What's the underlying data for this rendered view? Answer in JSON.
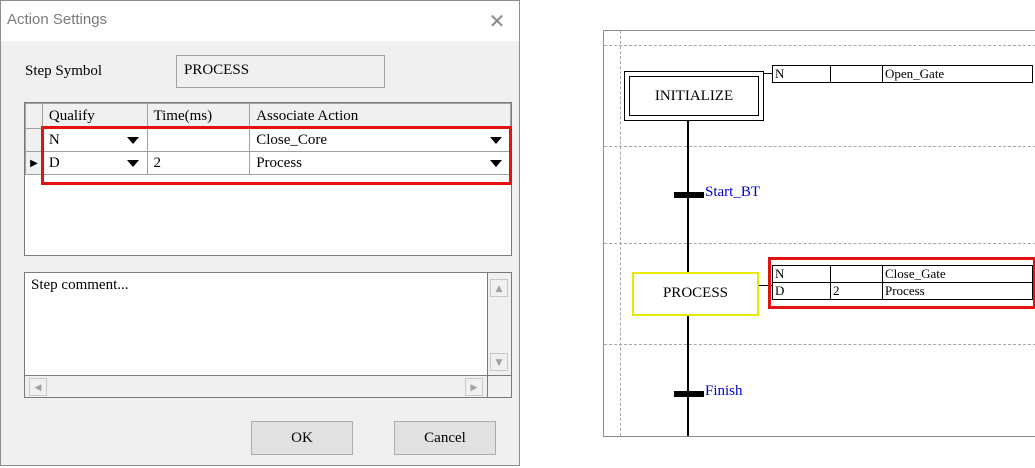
{
  "dialog": {
    "title": "Action Settings",
    "close_glyph": "✕",
    "step_symbol_label": "Step Symbol",
    "step_symbol_value": "PROCESS",
    "grid": {
      "columns": [
        "Qualify",
        "Time(ms)",
        "Associate Action"
      ],
      "rows": [
        {
          "marker": "",
          "qualify": "N",
          "time": "",
          "action": "Close_Core"
        },
        {
          "marker": "▶",
          "qualify": "D",
          "time": "2",
          "action": "Process"
        }
      ]
    },
    "comment_placeholder": "Step comment...",
    "ok_label": "OK",
    "cancel_label": "Cancel"
  },
  "sfc": {
    "init_step": "INITIALIZE",
    "init_action": {
      "qualify": "N",
      "time": "",
      "action": "Open_Gate"
    },
    "transition1": "Start_BT",
    "process_step": "PROCESS",
    "process_actions": [
      {
        "qualify": "N",
        "time": "",
        "action": "Close_Gate"
      },
      {
        "qualify": "D",
        "time": "2",
        "action": "Process"
      }
    ],
    "transition2": "Finish"
  },
  "colors": {
    "highlight": "#e31212",
    "process_step_border": "#e8e800",
    "transition_text": "#0000d0"
  }
}
